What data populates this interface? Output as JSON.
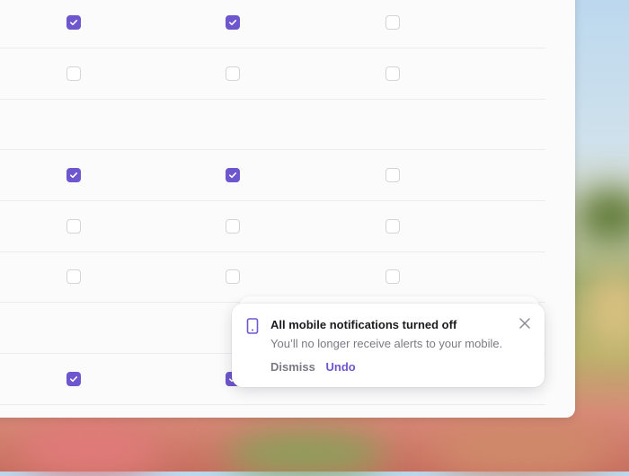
{
  "colors": {
    "accent": "#6e56cf",
    "unchecked_border": "#d4d4d8"
  },
  "notification_rows": [
    {
      "email": true,
      "desktop": true,
      "mobile": false
    },
    {
      "email": false,
      "desktop": false,
      "mobile": false
    },
    {
      "section_gap": true
    },
    {
      "email": true,
      "desktop": true,
      "mobile": false
    },
    {
      "email": false,
      "desktop": false,
      "mobile": false
    },
    {
      "email": false,
      "desktop": false,
      "mobile": false
    },
    {
      "section_gap": true
    },
    {
      "email": true,
      "desktop": true,
      "mobile": false
    }
  ],
  "toast": {
    "icon": "mobile-phone-icon",
    "title": "All mobile notifications turned off",
    "description": "You’ll no longer receive alerts to your mobile.",
    "dismiss_label": "Dismiss",
    "undo_label": "Undo",
    "close_icon": "close-icon"
  }
}
